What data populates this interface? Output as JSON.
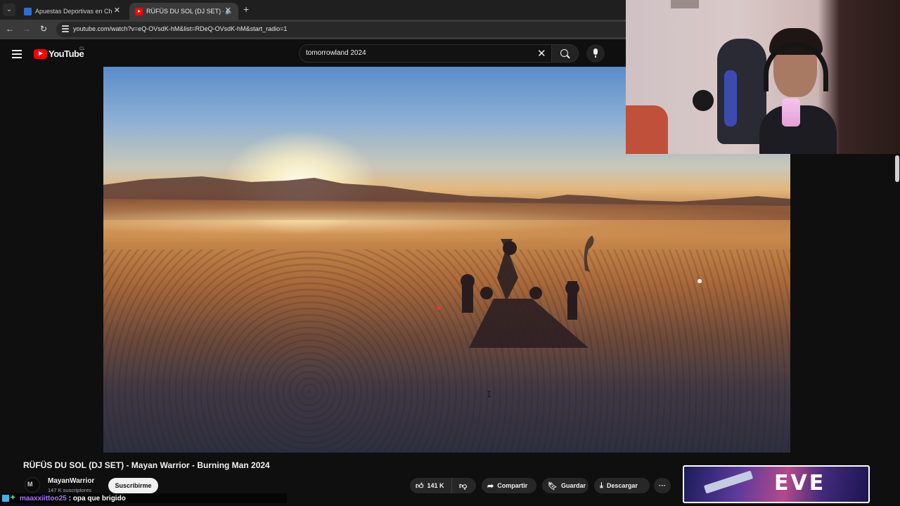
{
  "browser": {
    "tabs": [
      {
        "title": "Apuestas Deportivas en Chile |",
        "active": false
      },
      {
        "title": "RÜFÜS DU SOL (DJ SET) - M",
        "active": true
      }
    ],
    "url": "youtube.com/watch?v=eQ-OVsdK-hM&list=RDeQ-OVsdK-hM&start_radio=1"
  },
  "youtube": {
    "logo_text": "YouTube",
    "country_code": "CL",
    "search_value": "tomorrowland 2024"
  },
  "video": {
    "title": "RÜFÜS DU SOL (DJ SET) - Mayan Warrior - Burning Man 2024",
    "channel_avatar_text": "M",
    "channel_name": "MayanWarrior",
    "subscribers": "147 K suscriptores",
    "subscribe_label": "Suscribirme",
    "likes": "141 K",
    "share_label": "Compartir",
    "save_label": "Guardar",
    "download_label": "Descargar",
    "more_label": "···"
  },
  "chat": {
    "username": "maaxxiittoo25",
    "message": ": opa que brigido"
  },
  "ad": {
    "text": "EVE"
  },
  "colors": {
    "youtube_red": "#ff0000",
    "background": "#0f0f0f",
    "pill": "#272727",
    "chat_user": "#a970ff"
  }
}
